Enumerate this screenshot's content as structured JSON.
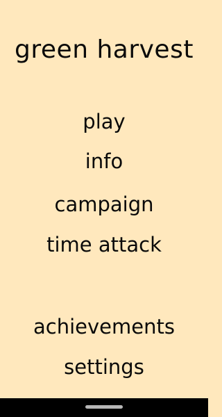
{
  "app": {
    "title": "green harvest"
  },
  "menu": {
    "items": [
      {
        "label": "play"
      },
      {
        "label": "info"
      },
      {
        "label": "campaign"
      },
      {
        "label": "time attack"
      },
      {
        "label": "achievements"
      },
      {
        "label": "settings"
      }
    ]
  },
  "colors": {
    "background": "#ffe8bd",
    "text": "#0a0a0a",
    "nav_bar": "#000000",
    "nav_pill": "#b6b6b6"
  },
  "icons": {
    "nav_handle": "gesture-handle-icon"
  }
}
